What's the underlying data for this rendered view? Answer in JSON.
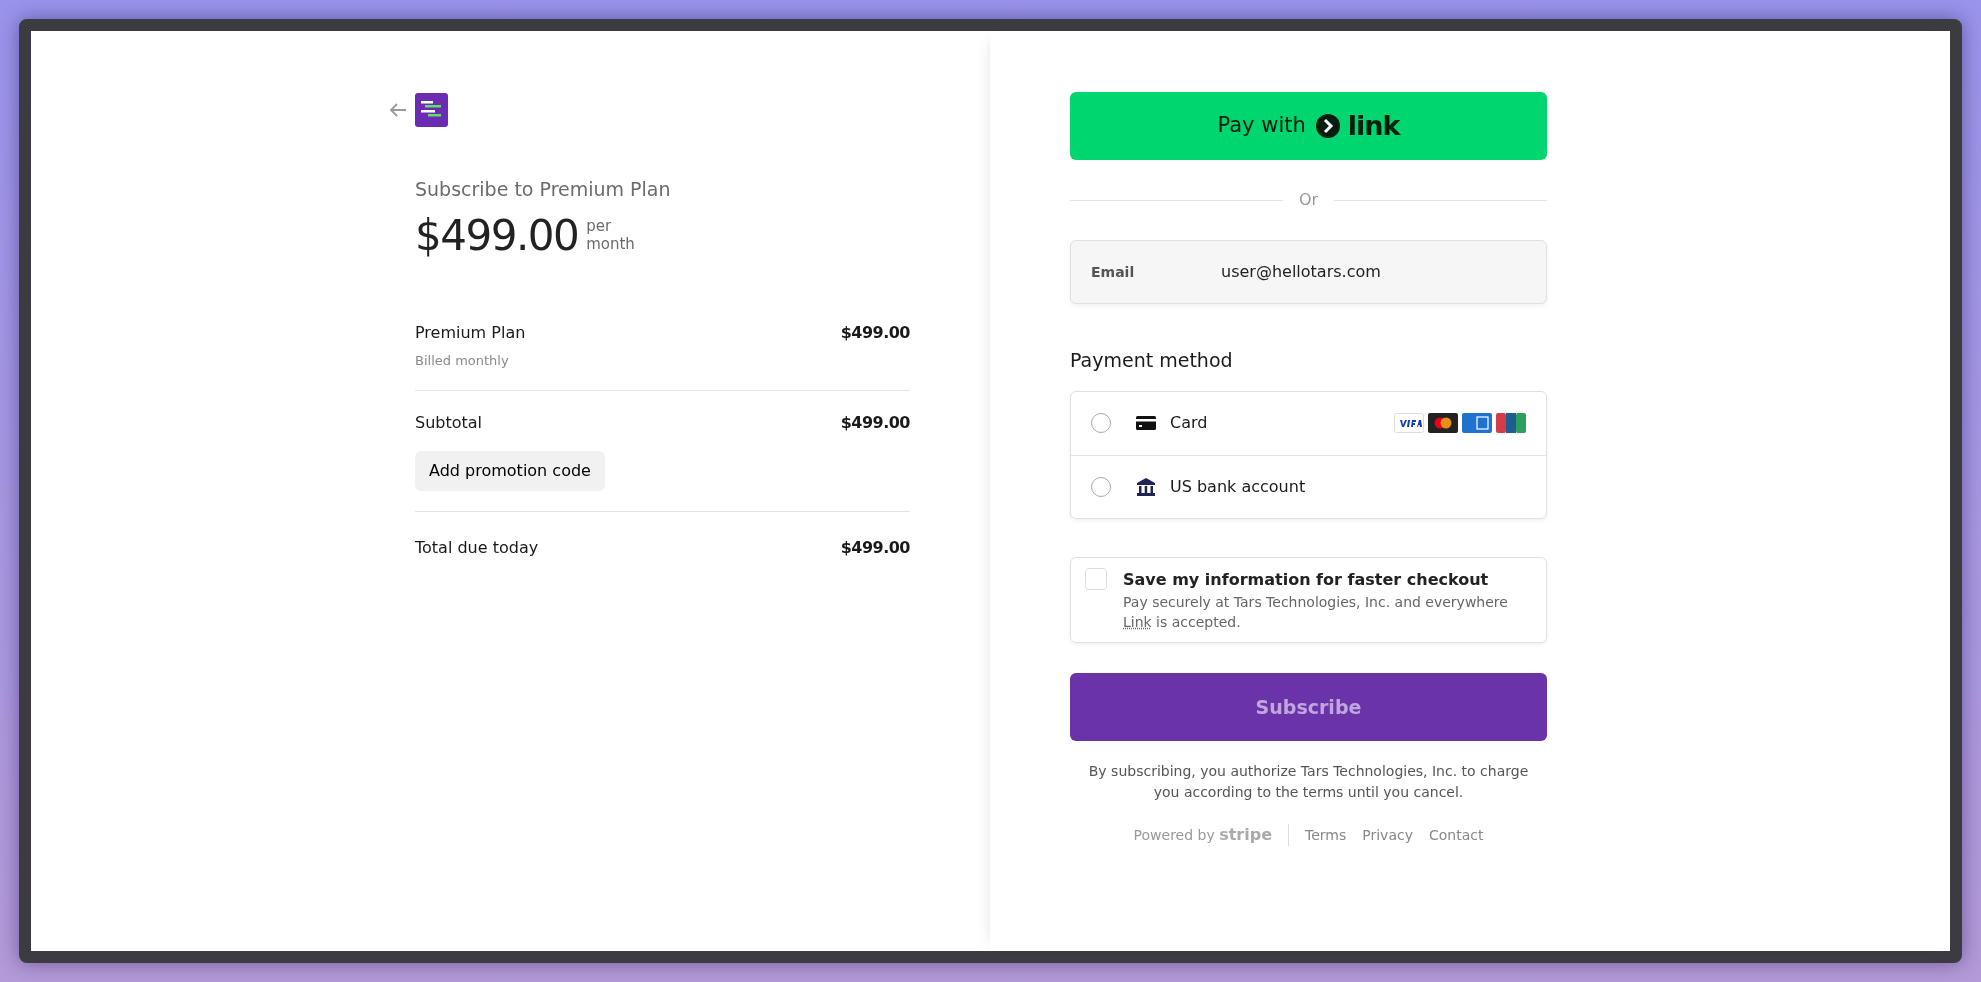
{
  "summary": {
    "title": "Subscribe to Premium Plan",
    "price": "$499.00",
    "period_top": "per",
    "period_bottom": "month",
    "items": [
      {
        "name": "Premium Plan",
        "detail": "Billed monthly",
        "amount": "$499.00"
      }
    ],
    "subtotal": {
      "label": "Subtotal",
      "amount": "$499.00"
    },
    "promo_button": "Add promotion code",
    "total": {
      "label": "Total due today",
      "amount": "$499.00"
    }
  },
  "payment": {
    "link_button": {
      "label": "Pay with",
      "logo_text": "link"
    },
    "divider": "Or",
    "email": {
      "label": "Email",
      "value": "user@hellotars.com"
    },
    "method_heading": "Payment method",
    "methods": [
      {
        "kind": "card",
        "label": "Card",
        "selected": false
      },
      {
        "kind": "bank",
        "label": "US bank account",
        "selected": false
      }
    ],
    "save_info": {
      "checked": false,
      "title": "Save my information for faster checkout",
      "text_before": "Pay securely at Tars Technologies, Inc. and everywhere",
      "link": "Link",
      "text_after": "is accepted."
    },
    "subscribe_button": {
      "label": "Subscribe",
      "disabled": true
    },
    "legal": "By subscribing, you authorize Tars Technologies, Inc. to charge you according to the terms until you cancel.",
    "footer": {
      "powered": "Powered by **stripe**",
      "links": [
        "Terms",
        "Privacy",
        "Contact"
      ]
    }
  }
}
